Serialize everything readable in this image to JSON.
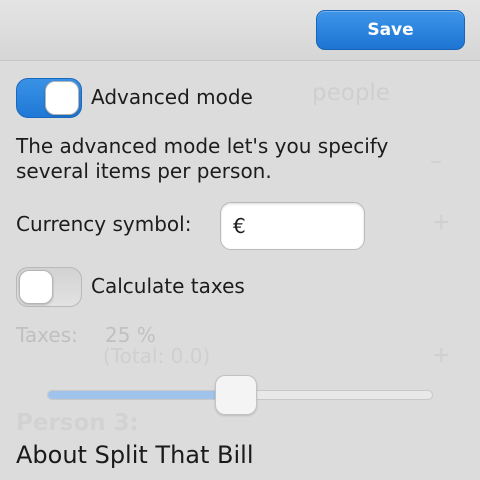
{
  "header": {
    "save_label": "Save"
  },
  "background": {
    "people_text": "people",
    "dash_text": "–",
    "plus_text": "+",
    "total_text": "(Total: 0.0)",
    "person_heading": "Person 3:"
  },
  "settings": {
    "advanced_mode": {
      "label": "Advanced mode",
      "enabled": true,
      "description": "The advanced mode let's you specify several items per person."
    },
    "currency": {
      "label": "Currency symbol:",
      "value": "€"
    },
    "taxes": {
      "toggle_label": "Calculate taxes",
      "enabled": false,
      "label": "Taxes:",
      "value_text": "25 %",
      "value": 25,
      "slider_fraction": 0.49
    }
  },
  "about_label": "About Split That Bill",
  "colors": {
    "accent": "#1f78d6",
    "background": "#dcdcdc",
    "disabled_text": "#c0c0c0"
  }
}
